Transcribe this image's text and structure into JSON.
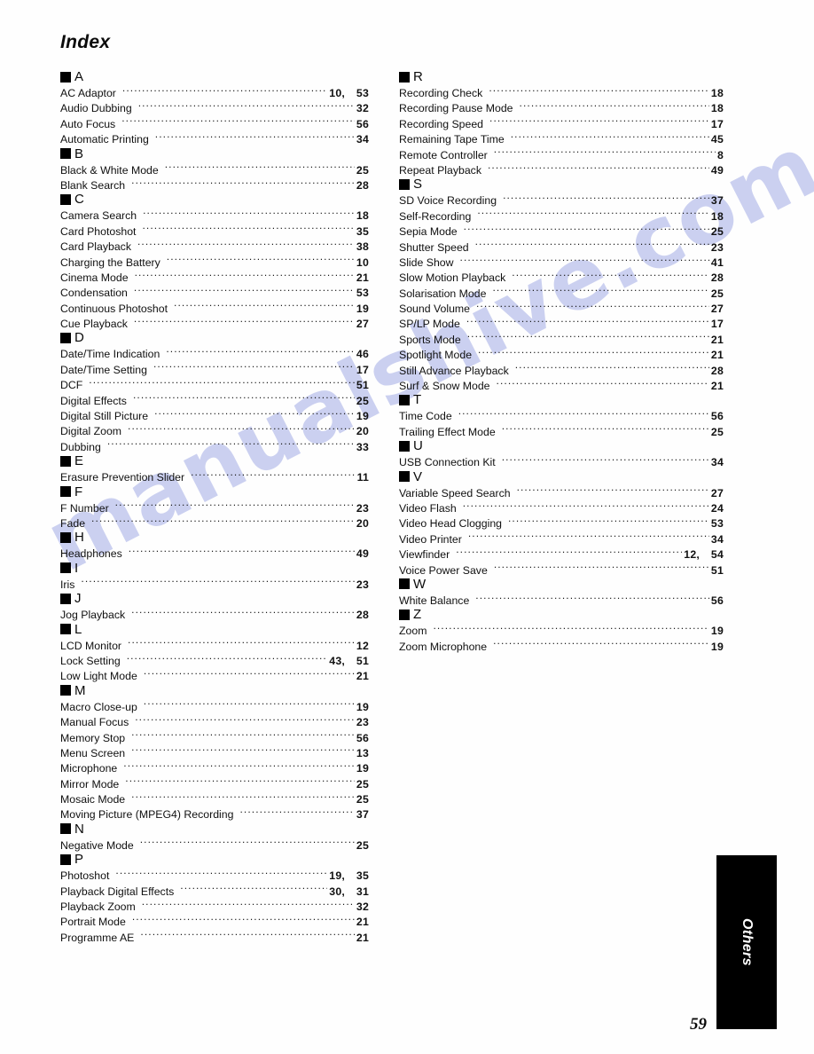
{
  "page": {
    "title": "Index",
    "number": "59",
    "side_tab_label": "Others",
    "watermark_text": "manualshive.com",
    "watermark_color": "#c3c9ee"
  },
  "columns": [
    {
      "id": "left",
      "sections": [
        {
          "letter": "A",
          "entries": [
            {
              "term": "AC Adaptor",
              "pages": [
                "10",
                "53"
              ]
            },
            {
              "term": "Audio Dubbing",
              "pages": [
                "32"
              ]
            },
            {
              "term": "Auto Focus",
              "pages": [
                "56"
              ]
            },
            {
              "term": "Automatic Printing",
              "pages": [
                "34"
              ]
            }
          ]
        },
        {
          "letter": "B",
          "entries": [
            {
              "term": "Black & White Mode",
              "pages": [
                "25"
              ]
            },
            {
              "term": "Blank Search",
              "pages": [
                "28"
              ]
            }
          ]
        },
        {
          "letter": "C",
          "entries": [
            {
              "term": "Camera Search",
              "pages": [
                "18"
              ]
            },
            {
              "term": "Card Photoshot",
              "pages": [
                "35"
              ]
            },
            {
              "term": "Card Playback",
              "pages": [
                "38"
              ]
            },
            {
              "term": "Charging the Battery",
              "pages": [
                "10"
              ]
            },
            {
              "term": "Cinema Mode",
              "pages": [
                "21"
              ]
            },
            {
              "term": "Condensation",
              "pages": [
                "53"
              ]
            },
            {
              "term": "Continuous Photoshot",
              "pages": [
                "19"
              ]
            },
            {
              "term": "Cue Playback",
              "pages": [
                "27"
              ]
            }
          ]
        },
        {
          "letter": "D",
          "entries": [
            {
              "term": "Date/Time Indication",
              "pages": [
                "46"
              ]
            },
            {
              "term": "Date/Time Setting",
              "pages": [
                "17"
              ]
            },
            {
              "term": "DCF",
              "pages": [
                "51"
              ]
            },
            {
              "term": "Digital Effects",
              "pages": [
                "25"
              ]
            },
            {
              "term": "Digital Still Picture",
              "pages": [
                "19"
              ]
            },
            {
              "term": "Digital Zoom",
              "pages": [
                "20"
              ]
            },
            {
              "term": "Dubbing",
              "pages": [
                "33"
              ]
            }
          ]
        },
        {
          "letter": "E",
          "entries": [
            {
              "term": "Erasure Prevention Slider",
              "pages": [
                "11"
              ]
            }
          ]
        },
        {
          "letter": "F",
          "entries": [
            {
              "term": "F Number",
              "pages": [
                "23"
              ]
            },
            {
              "term": "Fade",
              "pages": [
                "20"
              ]
            }
          ]
        },
        {
          "letter": "H",
          "entries": [
            {
              "term": "Headphones",
              "pages": [
                "49"
              ]
            }
          ]
        },
        {
          "letter": "I",
          "entries": [
            {
              "term": "Iris",
              "pages": [
                "23"
              ]
            }
          ]
        },
        {
          "letter": "J",
          "entries": [
            {
              "term": "Jog Playback",
              "pages": [
                "28"
              ]
            }
          ]
        },
        {
          "letter": "L",
          "entries": [
            {
              "term": "LCD Monitor",
              "pages": [
                "12"
              ]
            },
            {
              "term": "Lock Setting",
              "pages": [
                "43",
                "51"
              ]
            },
            {
              "term": "Low Light Mode",
              "pages": [
                "21"
              ]
            }
          ]
        },
        {
          "letter": "M",
          "entries": [
            {
              "term": "Macro Close-up",
              "pages": [
                "19"
              ]
            },
            {
              "term": "Manual Focus",
              "pages": [
                "23"
              ]
            },
            {
              "term": "Memory Stop",
              "pages": [
                "56"
              ]
            },
            {
              "term": "Menu Screen",
              "pages": [
                "13"
              ]
            },
            {
              "term": "Microphone",
              "pages": [
                "19"
              ]
            },
            {
              "term": "Mirror Mode",
              "pages": [
                "25"
              ]
            },
            {
              "term": "Mosaic Mode",
              "pages": [
                "25"
              ]
            },
            {
              "term": "Moving Picture (MPEG4) Recording",
              "pages": [
                "37"
              ]
            }
          ]
        },
        {
          "letter": "N",
          "entries": [
            {
              "term": "Negative Mode",
              "pages": [
                "25"
              ]
            }
          ]
        },
        {
          "letter": "P",
          "entries": [
            {
              "term": "Photoshot",
              "pages": [
                "19",
                "35"
              ]
            },
            {
              "term": "Playback Digital Effects",
              "pages": [
                "30",
                "31"
              ]
            },
            {
              "term": "Playback Zoom",
              "pages": [
                "32"
              ]
            },
            {
              "term": "Portrait Mode",
              "pages": [
                "21"
              ]
            },
            {
              "term": "Programme AE",
              "pages": [
                "21"
              ]
            }
          ]
        }
      ]
    },
    {
      "id": "right",
      "sections": [
        {
          "letter": "R",
          "entries": [
            {
              "term": "Recording Check",
              "pages": [
                "18"
              ]
            },
            {
              "term": "Recording Pause Mode",
              "pages": [
                "18"
              ]
            },
            {
              "term": "Recording Speed",
              "pages": [
                "17"
              ]
            },
            {
              "term": "Remaining Tape Time",
              "pages": [
                "45"
              ]
            },
            {
              "term": "Remote Controller",
              "pages": [
                "8"
              ]
            },
            {
              "term": "Repeat Playback",
              "pages": [
                "49"
              ]
            }
          ]
        },
        {
          "letter": "S",
          "entries": [
            {
              "term": "SD Voice Recording",
              "pages": [
                "37"
              ]
            },
            {
              "term": "Self-Recording",
              "pages": [
                "18"
              ]
            },
            {
              "term": "Sepia Mode",
              "pages": [
                "25"
              ]
            },
            {
              "term": "Shutter Speed",
              "pages": [
                "23"
              ]
            },
            {
              "term": "Slide Show",
              "pages": [
                "41"
              ]
            },
            {
              "term": "Slow Motion Playback",
              "pages": [
                "28"
              ]
            },
            {
              "term": "Solarisation Mode",
              "pages": [
                "25"
              ]
            },
            {
              "term": "Sound Volume",
              "pages": [
                "27"
              ]
            },
            {
              "term": "SP/LP Mode",
              "pages": [
                "17"
              ]
            },
            {
              "term": "Sports Mode",
              "pages": [
                "21"
              ]
            },
            {
              "term": "Spotlight Mode",
              "pages": [
                "21"
              ]
            },
            {
              "term": "Still Advance Playback",
              "pages": [
                "28"
              ]
            },
            {
              "term": "Surf & Snow Mode",
              "pages": [
                "21"
              ]
            }
          ]
        },
        {
          "letter": "T",
          "entries": [
            {
              "term": "Time Code",
              "pages": [
                "56"
              ]
            },
            {
              "term": "Trailing Effect Mode",
              "pages": [
                "25"
              ]
            }
          ]
        },
        {
          "letter": "U",
          "entries": [
            {
              "term": "USB Connection Kit",
              "pages": [
                "34"
              ]
            }
          ]
        },
        {
          "letter": "V",
          "entries": [
            {
              "term": "Variable Speed Search",
              "pages": [
                "27"
              ]
            },
            {
              "term": "Video Flash",
              "pages": [
                "24"
              ]
            },
            {
              "term": "Video Head Clogging",
              "pages": [
                "53"
              ]
            },
            {
              "term": "Video Printer",
              "pages": [
                "34"
              ]
            },
            {
              "term": "Viewfinder",
              "pages": [
                "12",
                "54"
              ]
            },
            {
              "term": "Voice Power Save",
              "pages": [
                "51"
              ]
            }
          ]
        },
        {
          "letter": "W",
          "entries": [
            {
              "term": "White Balance",
              "pages": [
                "56"
              ]
            }
          ]
        },
        {
          "letter": "Z",
          "entries": [
            {
              "term": "Zoom",
              "pages": [
                "19"
              ]
            },
            {
              "term": "Zoom Microphone",
              "pages": [
                "19"
              ]
            }
          ]
        }
      ]
    }
  ]
}
